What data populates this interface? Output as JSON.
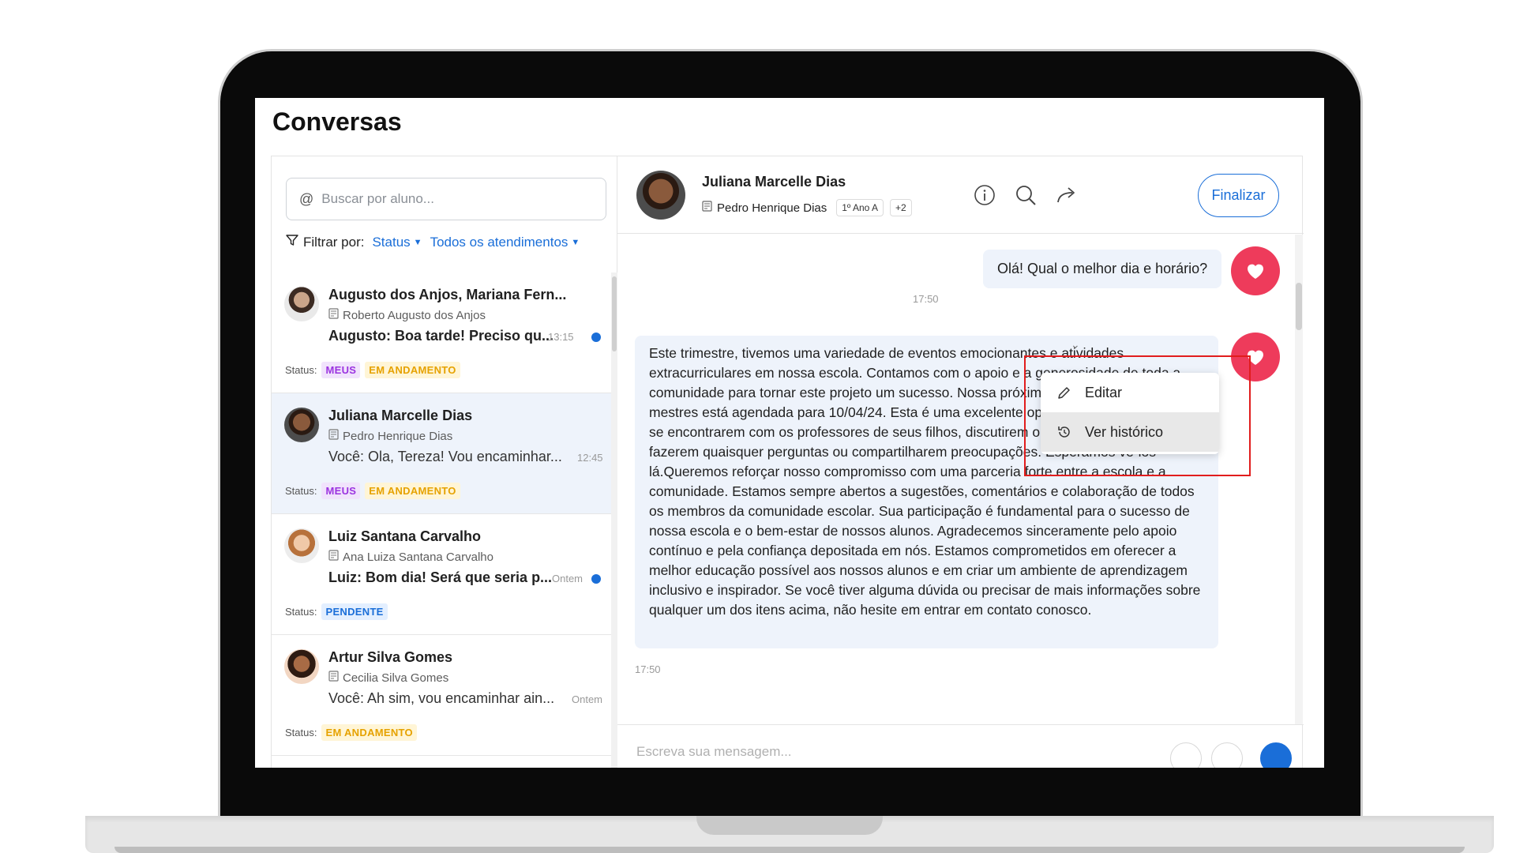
{
  "app": {
    "page_title": "Conversas"
  },
  "sidebar": {
    "search_placeholder": "Buscar por aluno...",
    "filter_label": "Filtrar por:",
    "filter_status": "Status",
    "filter_atendimentos": "Todos os atendimentos",
    "status_label": "Status:",
    "conversations": [
      {
        "name": "Augusto dos Anjos, Mariana Fern...",
        "student": "Roberto Augusto dos Anjos",
        "last_message": "Augusto: Boa tarde! Preciso qu...",
        "time": "13:15",
        "unread": true,
        "badges": [
          "MEUS",
          "EM ANDAMENTO"
        ]
      },
      {
        "name": "Juliana Marcelle Dias",
        "student": "Pedro Henrique Dias",
        "last_message": "Você: Ola, Tereza! Vou encaminhar...",
        "time": "12:45",
        "unread": false,
        "badges": [
          "MEUS",
          "EM ANDAMENTO"
        ]
      },
      {
        "name": "Luiz Santana Carvalho",
        "student": "Ana Luiza Santana Carvalho",
        "last_message": "Luiz: Bom dia! Será que seria p...",
        "time": "Ontem",
        "unread": true,
        "badges": [
          "PENDENTE"
        ]
      },
      {
        "name": "Artur Silva Gomes",
        "student": "Cecilia Silva Gomes",
        "last_message": "Você: Ah sim, vou encaminhar ain...",
        "time": "Ontem",
        "unread": false,
        "badges": [
          "EM ANDAMENTO"
        ]
      }
    ]
  },
  "chat": {
    "contact_name": "Juliana Marcelle Dias",
    "student": "Pedro Henrique Dias",
    "class_chip": "1º Ano A",
    "extra_chip": "+2",
    "finalize_label": "Finalizar",
    "messages": [
      {
        "text": "Olá! Qual o melhor dia e horário?",
        "time": "17:50"
      },
      {
        "text": "Este trimestre, tivemos uma variedade de eventos emocionantes e atividades extracurriculares em nossa escola. Contamos com o apoio e a generosidade de toda a comunidade para tornar este projeto um sucesso. Nossa próxima reunião de pais e mestres está agendada para 10/04/24. Esta é uma excelente oportunidade para os pais se encontrarem com os professores de seus filhos, discutirem o progresso acadêmico e fazerem quaisquer perguntas ou compartilharem preocupações. Esperamos vê-los lá.Queremos reforçar nosso compromisso com uma parceria forte entre a escola e a comunidade. Estamos sempre abertos a sugestões, comentários e colaboração de todos os membros da comunidade escolar. Sua participação é fundamental para o sucesso de nossa escola e o bem-estar de nossos alunos. Agradecemos sinceramente pelo apoio contínuo e pela confiança depositada em nós. Estamos comprometidos em oferecer a melhor educação possível aos nossos alunos e em criar um ambiente de aprendizagem inclusivo e inspirador. Se você tiver alguma dúvida ou precisar de mais informações sobre qualquer um dos itens acima, não hesite em entrar em contato conosco.",
        "time": "17:50"
      }
    ],
    "context_menu": {
      "edit_label": "Editar",
      "history_label": "Ver histórico"
    },
    "composer_placeholder": "Escreva sua mensagem..."
  },
  "colors": {
    "accent": "#1a6ed8",
    "heart": "#ee3b5b",
    "highlight_box": "#e11d1d"
  }
}
